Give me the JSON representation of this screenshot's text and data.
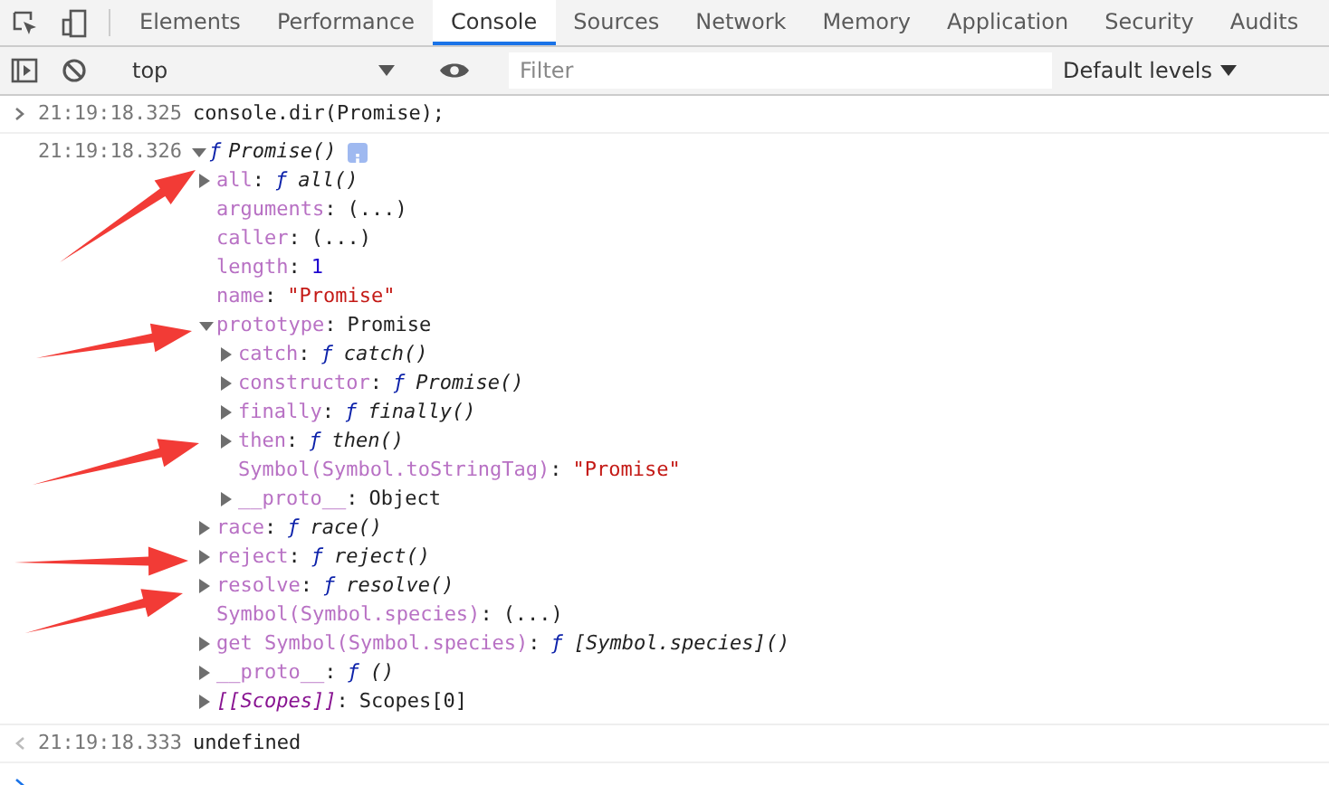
{
  "tabs_bar": {
    "tabs": [
      {
        "label": "Elements",
        "selected": false
      },
      {
        "label": "Performance",
        "selected": false
      },
      {
        "label": "Console",
        "selected": true
      },
      {
        "label": "Sources",
        "selected": false
      },
      {
        "label": "Network",
        "selected": false
      },
      {
        "label": "Memory",
        "selected": false
      },
      {
        "label": "Application",
        "selected": false
      },
      {
        "label": "Security",
        "selected": false
      },
      {
        "label": "Audits",
        "selected": false
      }
    ]
  },
  "toolbar": {
    "context": "top",
    "filter": {
      "placeholder": "Filter"
    },
    "levels": "Default levels"
  },
  "console": {
    "messages": [
      {
        "kind": "input",
        "time": "21:19:18.325",
        "text": "console.dir(Promise);"
      },
      {
        "kind": "output",
        "time": "21:19:18.326",
        "root": {
          "prefix": "ƒ",
          "label": "Promise()",
          "expanded": true,
          "children": [
            {
              "kind": "branch",
              "expanded": false,
              "key": "all",
              "sep": ":",
              "value": {
                "kind": "function",
                "prefix": "ƒ",
                "text": "all()"
              }
            },
            {
              "kind": "leaf",
              "key": "arguments",
              "sep": ":",
              "value": {
                "kind": "getter",
                "text": "(...)"
              }
            },
            {
              "kind": "leaf",
              "key": "caller",
              "sep": ":",
              "value": {
                "kind": "getter",
                "text": "(...)"
              }
            },
            {
              "kind": "leaf",
              "key": "length",
              "sep": ":",
              "value": {
                "kind": "number",
                "text": "1"
              }
            },
            {
              "kind": "leaf",
              "key": "name",
              "sep": ":",
              "value": {
                "kind": "string",
                "text": "\"Promise\""
              }
            },
            {
              "kind": "branch",
              "expanded": true,
              "key": "prototype",
              "sep": ":",
              "value": {
                "kind": "object",
                "text": "Promise"
              },
              "children": [
                {
                  "kind": "branch",
                  "expanded": false,
                  "key": "catch",
                  "sep": ":",
                  "value": {
                    "kind": "function",
                    "prefix": "ƒ",
                    "text": "catch()"
                  }
                },
                {
                  "kind": "branch",
                  "expanded": false,
                  "key": "constructor",
                  "sep": ":",
                  "value": {
                    "kind": "function",
                    "prefix": "ƒ",
                    "text": "Promise()"
                  }
                },
                {
                  "kind": "branch",
                  "expanded": false,
                  "key": "finally",
                  "sep": ":",
                  "value": {
                    "kind": "function",
                    "prefix": "ƒ",
                    "text": "finally()"
                  }
                },
                {
                  "kind": "branch",
                  "expanded": false,
                  "key": "then",
                  "sep": ":",
                  "value": {
                    "kind": "function",
                    "prefix": "ƒ",
                    "text": "then()"
                  }
                },
                {
                  "kind": "leaf",
                  "key": "Symbol(Symbol.toStringTag)",
                  "sep": ":",
                  "value": {
                    "kind": "string",
                    "text": "\"Promise\""
                  }
                },
                {
                  "kind": "branch",
                  "expanded": false,
                  "key": "__proto__",
                  "sep": ":",
                  "value": {
                    "kind": "object",
                    "text": "Object"
                  }
                }
              ]
            },
            {
              "kind": "branch",
              "expanded": false,
              "key": "race",
              "sep": ":",
              "value": {
                "kind": "function",
                "prefix": "ƒ",
                "text": "race()"
              }
            },
            {
              "kind": "branch",
              "expanded": false,
              "key": "reject",
              "sep": ":",
              "value": {
                "kind": "function",
                "prefix": "ƒ",
                "text": "reject()"
              }
            },
            {
              "kind": "branch",
              "expanded": false,
              "key": "resolve",
              "sep": ":",
              "value": {
                "kind": "function",
                "prefix": "ƒ",
                "text": "resolve()"
              }
            },
            {
              "kind": "leaf",
              "key": "Symbol(Symbol.species)",
              "sep": ":",
              "value": {
                "kind": "getter",
                "text": "(...)"
              }
            },
            {
              "kind": "branch",
              "expanded": false,
              "key": "get Symbol(Symbol.species)",
              "sep": ":",
              "value": {
                "kind": "function",
                "prefix": "ƒ",
                "text": "[Symbol.species]()"
              }
            },
            {
              "kind": "branch",
              "expanded": false,
              "key": "__proto__",
              "sep": ":",
              "value": {
                "kind": "function",
                "prefix": "ƒ",
                "text": "()"
              }
            },
            {
              "kind": "branch",
              "expanded": false,
              "key": "[[Scopes]]",
              "internal": true,
              "sep": ":",
              "value": {
                "kind": "object",
                "text": "Scopes[0]"
              }
            }
          ]
        }
      },
      {
        "kind": "result",
        "time": "21:19:18.333",
        "text": "undefined"
      }
    ]
  }
}
